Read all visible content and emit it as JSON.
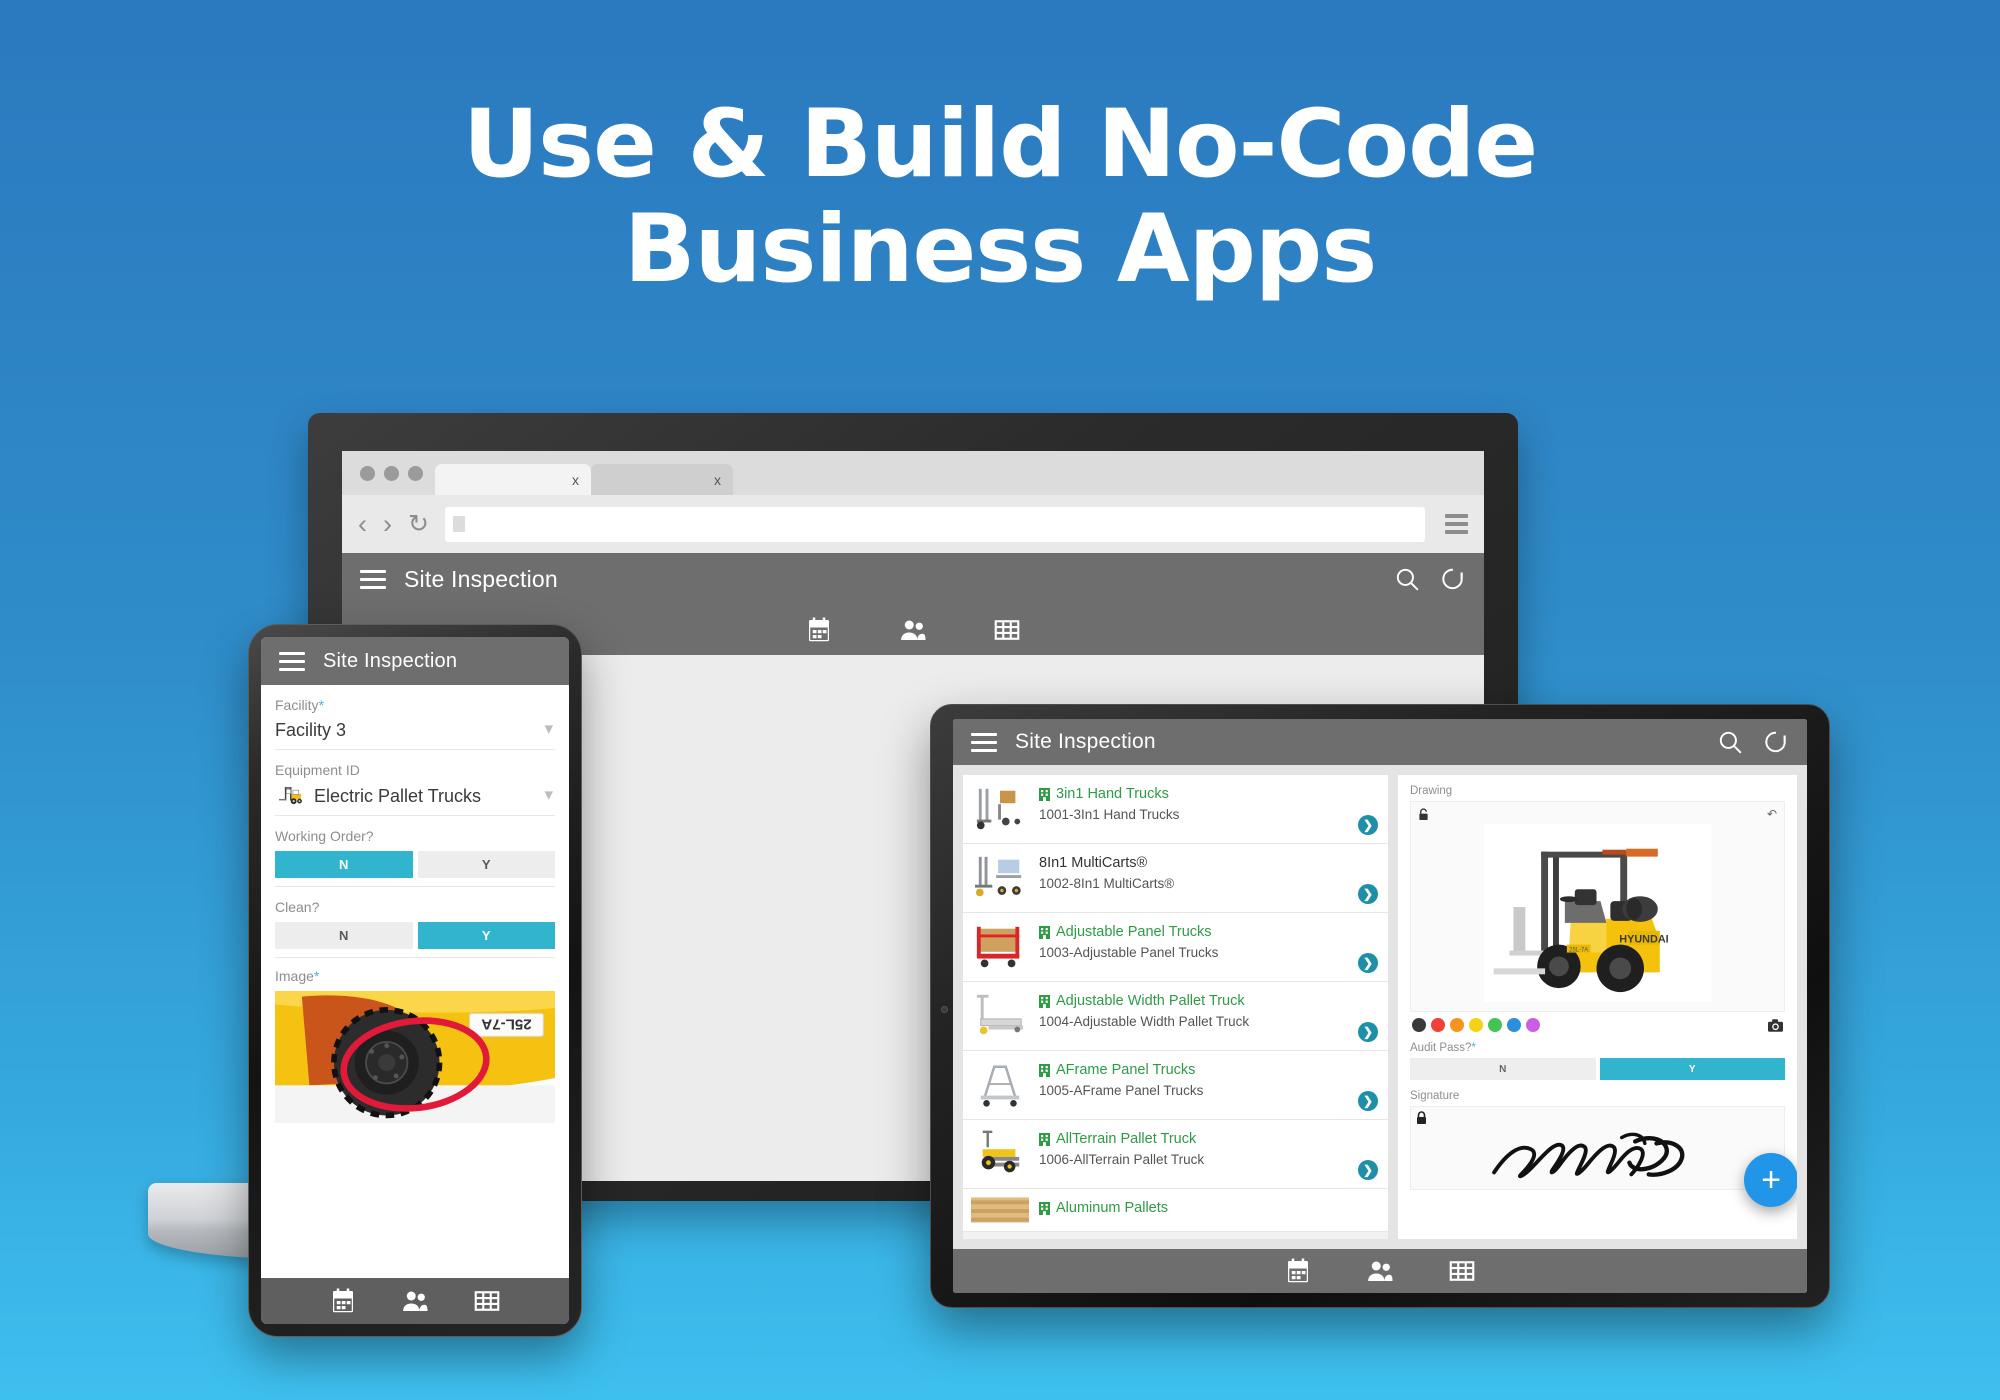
{
  "headline": {
    "line1": "Use & Build No-Code",
    "line2": "Business Apps"
  },
  "colors": {
    "background_top": "#2b79bf",
    "background_bottom": "#3ec0ef",
    "accent_teal": "#31b4cd",
    "accent_blue": "#2196e8",
    "list_title_green": "#2e9b45",
    "alert_red": "#d01622",
    "marker_yellow": "#d9bc1b",
    "marker_green": "#1faa3c",
    "appbar_gray": "#6e6e6e"
  },
  "browser": {
    "tabs": [
      {
        "close_label": "x"
      },
      {
        "close_label": "x"
      }
    ],
    "back_icon": "chevron-left-icon",
    "forward_icon": "chevron-right-icon",
    "reload_icon": "reload-icon",
    "url_value": "",
    "url_placeholder": "",
    "menu_icon": "hamburger-menu-icon"
  },
  "laptop_app": {
    "appbar": {
      "menu_icon": "hamburger-menu-icon",
      "title": "Site Inspection",
      "search_icon": "search-icon",
      "refresh_icon": "refresh-icon"
    },
    "bottom_nav": [
      {
        "icon": "calendar-icon"
      },
      {
        "icon": "people-icon"
      },
      {
        "icon": "grid-icon"
      }
    ]
  },
  "phone_app": {
    "appbar": {
      "menu_icon": "hamburger-menu-icon",
      "title": "Site Inspection"
    },
    "fields": [
      {
        "label": "Facility",
        "required": "*",
        "value": "Facility 3",
        "type": "dropdown",
        "chevron_icon": "chevron-down-icon"
      },
      {
        "label": "Equipment ID",
        "required": "",
        "value": "Electric Pallet Trucks",
        "type": "dropdown-with-image",
        "thumb_icon": "forklift-icon",
        "chevron_icon": "chevron-down-icon"
      },
      {
        "label": "Working Order?",
        "required": "",
        "type": "toggle",
        "options": [
          "N",
          "Y"
        ],
        "selected": "N"
      },
      {
        "label": "Clean?",
        "required": "",
        "type": "toggle",
        "options": [
          "N",
          "Y"
        ],
        "selected": "Y"
      },
      {
        "label": "Image",
        "required": "*",
        "type": "photo",
        "photo_caption": "forklift-tire-photo-annotated"
      }
    ],
    "bottom_nav": [
      {
        "icon": "calendar-icon"
      },
      {
        "icon": "people-icon"
      },
      {
        "icon": "grid-icon"
      }
    ]
  },
  "tablet_app": {
    "appbar": {
      "menu_icon": "hamburger-menu-icon",
      "title": "Site Inspection",
      "search_icon": "search-icon",
      "refresh_icon": "refresh-icon"
    },
    "list": [
      {
        "title": "3in1 Hand Trucks",
        "subtitle": "1001-3In1 Hand Trucks",
        "badge": "building-icon",
        "has_badge": true,
        "arrow": "chevron-right-circle-icon",
        "thumb": "hand-truck-thumb"
      },
      {
        "title": "8In1 MultiCarts®",
        "subtitle": "1002-8In1 MultiCarts®",
        "badge": "",
        "has_badge": false,
        "arrow": "chevron-right-circle-icon",
        "thumb": "multicart-thumb"
      },
      {
        "title": "Adjustable Panel Trucks",
        "subtitle": "1003-Adjustable Panel Trucks",
        "badge": "building-icon",
        "has_badge": true,
        "arrow": "chevron-right-circle-icon",
        "thumb": "panel-truck-thumb"
      },
      {
        "title": "Adjustable Width Pallet Truck",
        "subtitle": "1004-Adjustable Width Pallet Truck",
        "badge": "building-icon",
        "has_badge": true,
        "arrow": "chevron-right-circle-icon",
        "thumb": "pallet-truck-thumb"
      },
      {
        "title": "AFrame Panel Trucks",
        "subtitle": "1005-AFrame Panel Trucks",
        "badge": "building-icon",
        "has_badge": true,
        "arrow": "chevron-right-circle-icon",
        "thumb": "aframe-thumb"
      },
      {
        "title": "AllTerrain Pallet Truck",
        "subtitle": "1006-AllTerrain Pallet Truck",
        "badge": "building-icon",
        "has_badge": true,
        "arrow": "chevron-right-circle-icon",
        "thumb": "allterrain-thumb"
      },
      {
        "title": "Aluminum Pallets",
        "subtitle": "",
        "badge": "building-icon",
        "has_badge": true,
        "arrow": "",
        "thumb": "aluminum-pallet-thumb"
      }
    ],
    "detail": {
      "drawing_label": "Drawing",
      "drawing_lock_icon": "unlock-icon",
      "drawing_undo_icon": "undo-icon",
      "drawing_image": "hyundai-forklift-photo",
      "palette": [
        "#3a3a3a",
        "#ef4136",
        "#f7941e",
        "#f7d117",
        "#45c455",
        "#2b8fe0",
        "#cc5fe0"
      ],
      "camera_icon": "camera-icon",
      "audit_label": "Audit Pass?",
      "audit_required": "*",
      "audit_options": [
        "N",
        "Y"
      ],
      "audit_selected": "Y",
      "signature_label": "Signature",
      "signature_lock_icon": "lock-icon",
      "signature_value": "Steven Jobs",
      "fab_label": "+",
      "fab_icon": "add-icon"
    },
    "bottom_nav": [
      {
        "icon": "calendar-icon"
      },
      {
        "icon": "people-icon"
      },
      {
        "icon": "grid-icon"
      }
    ]
  }
}
